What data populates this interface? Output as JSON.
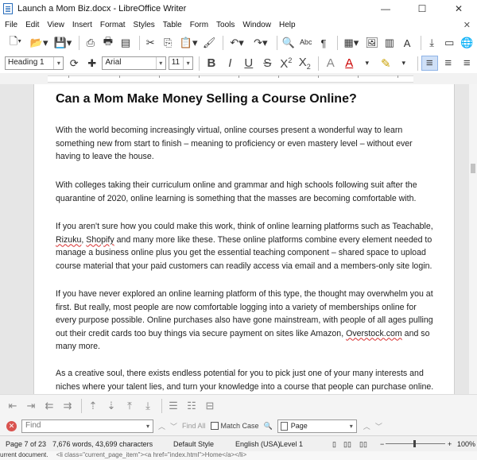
{
  "window": {
    "title": "Launch a Mom Biz.docx - LibreOffice Writer",
    "minimize": "—",
    "maximize": "☐",
    "close": "✕"
  },
  "menu": [
    "File",
    "Edit",
    "View",
    "Insert",
    "Format",
    "Styles",
    "Table",
    "Form",
    "Tools",
    "Window",
    "Help"
  ],
  "toolbar2": {
    "paragraph_style": "Heading 1",
    "font_name": "Arial",
    "font_size": "11"
  },
  "document": {
    "title": "Can a Mom Make Money Selling a Course Online?",
    "paragraphs": [
      [
        "With the world becoming increasingly virtual, online courses present a wonderful way to learn",
        "something new from start to finish – meaning to proficiency or even mastery level – without ever",
        "having to leave the house."
      ],
      [
        "With colleges taking their curriculum online and grammar and high schools following suit after the",
        "quarantine of 2020, online learning is something that the masses are becoming comfortable with."
      ],
      [
        "If you aren't sure how you could make this work, think of online learning platforms such as Teachable,",
        "Rizuku, Shopify and many more like these. These online platforms combine every element needed to",
        "manage a business online plus you get the essential teaching component –  shared space to upload",
        "course material that your paid customers can readily access via email and a members-only site login."
      ],
      [
        "If you have never explored an online learning platform of this type, the thought may overwhelm you at",
        "first. But really, most people are now comfortable logging into a variety of memberships online for",
        "every purpose possible.  Online purchases also have gone mainstream, with people of all ages pulling",
        "out their credit cards too buy things via secure payment on sites like Amazon, Overstock.com and so",
        "many more."
      ],
      [
        "As a creative soul, there exists endless potential for you to pick just one of your many interests and",
        "niches where your talent lies, and turn your knowledge into a course that people can purchase online."
      ]
    ]
  },
  "findbar": {
    "placeholder": "Find",
    "find_all": "Find All",
    "match_case": "Match Case",
    "search_scope": "Page"
  },
  "status": {
    "page": "Page 7 of 23",
    "words": "7,676 words, 43,699 characters",
    "style": "Default Style",
    "language": "English (USA)",
    "level": "Level 1",
    "zoom": "100%",
    "zoom_fraction": 0.47
  },
  "taskstrip": {
    "text": "urrent document.",
    "code": "<li class=\"current_page_item\"><a href=\"index.html\">Home</a></li>"
  }
}
